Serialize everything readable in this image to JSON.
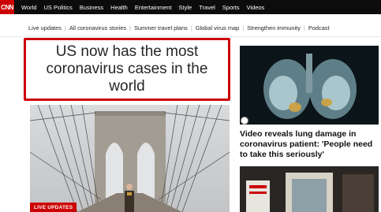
{
  "brand": {
    "logo_text": "CNN",
    "accent": "#cc0000",
    "nav_bg": "#0c0c0c"
  },
  "topnav": {
    "items": [
      "World",
      "US Politics",
      "Business",
      "Health",
      "Entertainment",
      "Style",
      "Travel",
      "Sports",
      "Videos"
    ]
  },
  "subnav": {
    "items": [
      "Live updates",
      "All coronavirus stories",
      "Summer travel plans",
      "Global virus map",
      "Strengthen immunity",
      "Podcast"
    ]
  },
  "main": {
    "headline": "US now has the most coronavirus cases in the world",
    "badge": "LIVE UPDATES"
  },
  "side": {
    "video_title": "Video reveals lung damage in coronavirus patient: 'People need to take this seriously'"
  }
}
